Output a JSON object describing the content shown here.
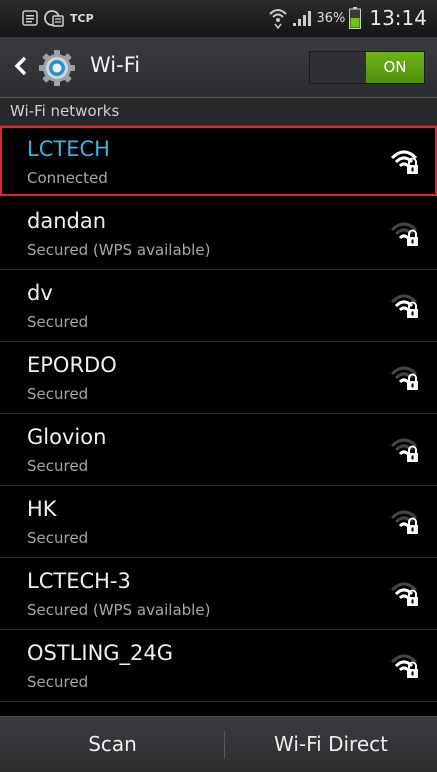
{
  "status_bar": {
    "tcp_label": "TCP",
    "battery_percent": "36%",
    "time": "13:14",
    "icons": [
      "notification-icon",
      "sync-icon",
      "wifi-data-icon",
      "signal-icon",
      "battery-icon"
    ]
  },
  "action_bar": {
    "title": "Wi-Fi",
    "toggle_label": "ON",
    "toggle_state": true,
    "icons": [
      "back-icon",
      "gear-icon"
    ],
    "accent_color": "#33b5e5",
    "toggle_color": "#5fa514"
  },
  "section": {
    "header": "Wi-Fi networks"
  },
  "networks": [
    {
      "name": "LCTECH",
      "status": "Connected",
      "connected": true
    },
    {
      "name": "dandan",
      "status": "Secured (WPS available)"
    },
    {
      "name": "dv",
      "status": "Secured"
    },
    {
      "name": "EPORDO",
      "status": "Secured"
    },
    {
      "name": "Glovion",
      "status": "Secured"
    },
    {
      "name": "HK",
      "status": "Secured"
    },
    {
      "name": "LCTECH-3",
      "status": "Secured (WPS available)"
    },
    {
      "name": "OSTLING_24G",
      "status": "Secured"
    }
  ],
  "bottom_bar": {
    "scan_label": "Scan",
    "wifi_direct_label": "Wi-Fi Direct"
  }
}
